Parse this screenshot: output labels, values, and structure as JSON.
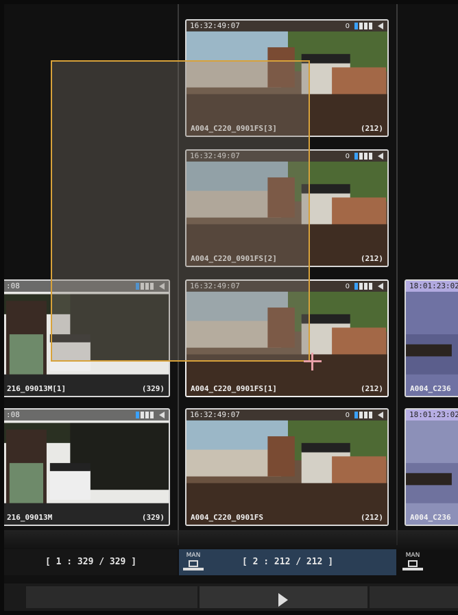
{
  "clips": [
    {
      "timecode": "16:32:49:07",
      "status_count": "0",
      "name": "A004_C220_0901FS[3]",
      "count": "(212)"
    },
    {
      "timecode": "16:32:49:07",
      "status_count": "0",
      "name": "A004_C220_0901FS[2]",
      "count": "(212)"
    },
    {
      "timecode": "16:32:49:07",
      "status_count": "0",
      "name": "A004_C220_0901FS[1]",
      "count": "(212)"
    },
    {
      "timecode": "16:32:49:07",
      "status_count": "0",
      "name": "A004_C220_0901FS",
      "count": "(212)"
    },
    {
      "timecode": ":08",
      "name": "216_09013M[1]",
      "count": "(329)"
    },
    {
      "timecode": ":08",
      "name": "216_09013M",
      "count": "(329)"
    },
    {
      "timecode": "18:01:23:02",
      "name": "A004_C236"
    },
    {
      "timecode": "18:01:23:02",
      "name": "A004_C236"
    }
  ],
  "reels": {
    "left_label": "[ 1 : 329 / 329 ]",
    "mid_label": "[ 2 : 212 / 212 ]",
    "man_label_1": "MAN",
    "man_label_2": "MAN"
  },
  "icons": {
    "speaker": "speaker-icon",
    "play": "play-icon",
    "man": "man-mode-icon"
  },
  "colors": {
    "selection_border": "#d8a23a",
    "active_reel": "#2a3e55",
    "status_blue": "#3aa1ff"
  }
}
